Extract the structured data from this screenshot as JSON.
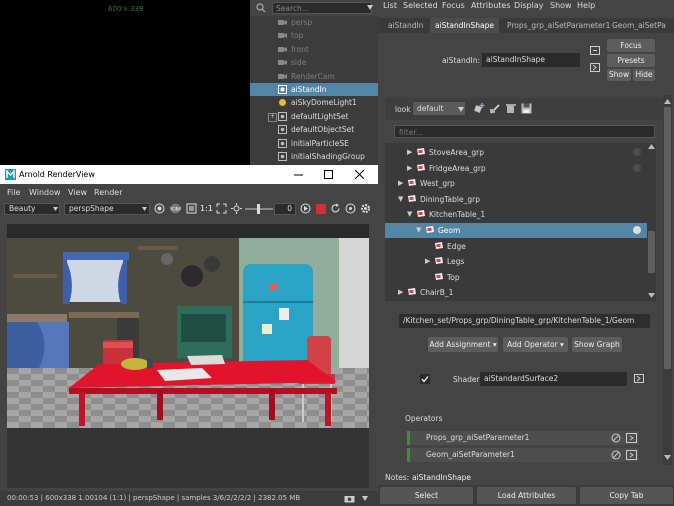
{
  "viewport": {
    "resolution_label": "600 x 338"
  },
  "outliner": {
    "search_placeholder": "Search...",
    "items": [
      {
        "label": "persp",
        "dim": true
      },
      {
        "label": "top",
        "dim": true
      },
      {
        "label": "front",
        "dim": true
      },
      {
        "label": "side",
        "dim": true
      },
      {
        "label": "RenderCam",
        "dim": true
      },
      {
        "label": "aiStandIn",
        "selected": true
      },
      {
        "label": "aiSkyDomeLight1"
      },
      {
        "label": "defaultLightSet",
        "expandable": true
      },
      {
        "label": "defaultObjectSet"
      },
      {
        "label": "initialParticleSE"
      },
      {
        "label": "initialShadingGroup"
      }
    ]
  },
  "ae": {
    "menu": [
      "List",
      "Selected",
      "Focus",
      "Attributes",
      "Display",
      "Show",
      "Help"
    ],
    "tabs": [
      "aiStandIn",
      "aiStandInShape",
      "Props_grp_aiSetParameter1",
      "Geom_aiSetPa"
    ],
    "standin_label": "aiStandIn:",
    "standin_value": "aiStandInShape",
    "focus_btn": "Focus",
    "presets_btn": "Presets",
    "show_btn": "Show",
    "hide_btn": "Hide",
    "look_label": "look",
    "look_value": "default",
    "filter_placeholder": "filter...",
    "tree": [
      {
        "label": "StoveArea_grp",
        "indent": 2,
        "arrow": "▶"
      },
      {
        "label": "FridgeArea_grp",
        "indent": 2,
        "arrow": "▶"
      },
      {
        "label": "West_grp",
        "indent": 1,
        "arrow": "▶"
      },
      {
        "label": "DiningTable_grp",
        "indent": 1,
        "arrow": "▼"
      },
      {
        "label": "KitchenTable_1",
        "indent": 2,
        "arrow": "▼"
      },
      {
        "label": "Geom",
        "indent": 3,
        "arrow": "▼",
        "selected": true
      },
      {
        "label": "Edge",
        "indent": 4,
        "arrow": ""
      },
      {
        "label": "Legs",
        "indent": 4,
        "arrow": "▶"
      },
      {
        "label": "Top",
        "indent": 4,
        "arrow": ""
      },
      {
        "label": "ChairB_1",
        "indent": 1,
        "arrow": "▶"
      }
    ],
    "path": "/Kitchen_set/Props_grp/DiningTable_grp/KitchenTable_1/Geom",
    "add_assignment": "Add Assignment",
    "add_operator": "Add Operator",
    "show_graph": "Show Graph",
    "shader_label": "Shader",
    "shader_value": "aiStandardSurface2",
    "operators_heading": "Operators",
    "operators": [
      "Props_grp_aiSetParameter1",
      "Geom_aiSetParameter1"
    ],
    "notes_label": "Notes:",
    "notes_value": "aiStandInShape",
    "bottom_buttons": [
      "Select",
      "Load Attributes",
      "Copy Tab"
    ]
  },
  "renderview": {
    "title": "Arnold RenderView",
    "menu": [
      "File",
      "Window",
      "View",
      "Render"
    ],
    "aov": "Beauty",
    "camera": "perspShape",
    "ratio": "1:1",
    "exposure": "0",
    "status": "00:00:53 | 600x338 1.00104 (1:1) | perspShape | samples 3/6/2/2/2/2 | 2382.05 MB"
  },
  "colors": {
    "selection": "#5285a6",
    "operator_accent": "#3b8f3b",
    "stop_red": "#d43030",
    "table_red": "#e2142b"
  }
}
